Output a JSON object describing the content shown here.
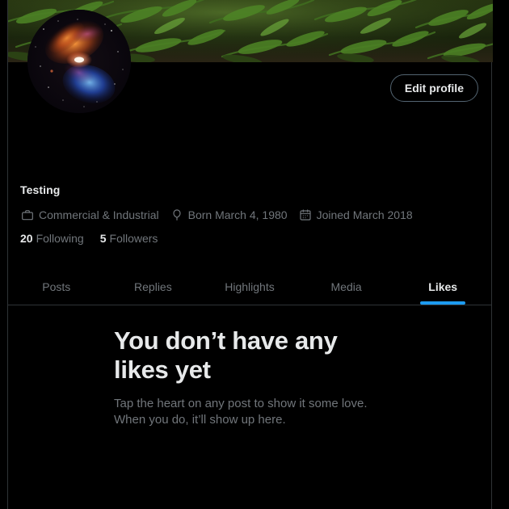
{
  "theme": {
    "background": "#000000",
    "text_primary": "#e7e9ea",
    "text_secondary": "#71767b",
    "border": "#2f3336",
    "accent": "#1d9bf0",
    "button_border": "#536471"
  },
  "banner": {
    "alt": "green ferns foliage banner image"
  },
  "avatar": {
    "alt": "nebula space photo avatar"
  },
  "header": {
    "edit_profile_label": "Edit profile"
  },
  "profile": {
    "display_name": "Testing",
    "meta": [
      {
        "icon": "briefcase-icon",
        "text": "Commercial & Industrial"
      },
      {
        "icon": "balloon-icon",
        "text": "Born March 4, 1980"
      },
      {
        "icon": "calendar-icon",
        "text": "Joined March 2018"
      }
    ],
    "following": {
      "count": "20",
      "label": "Following"
    },
    "followers": {
      "count": "5",
      "label": "Followers"
    }
  },
  "tabs": [
    {
      "label": "Posts",
      "active": false
    },
    {
      "label": "Replies",
      "active": false
    },
    {
      "label": "Highlights",
      "active": false
    },
    {
      "label": "Media",
      "active": false
    },
    {
      "label": "Likes",
      "active": true
    }
  ],
  "empty_state": {
    "title": "You don’t have any likes yet",
    "subtitle_line1": "Tap the heart on any post to show it some love.",
    "subtitle_line2": "When you do, it’ll show up here."
  }
}
